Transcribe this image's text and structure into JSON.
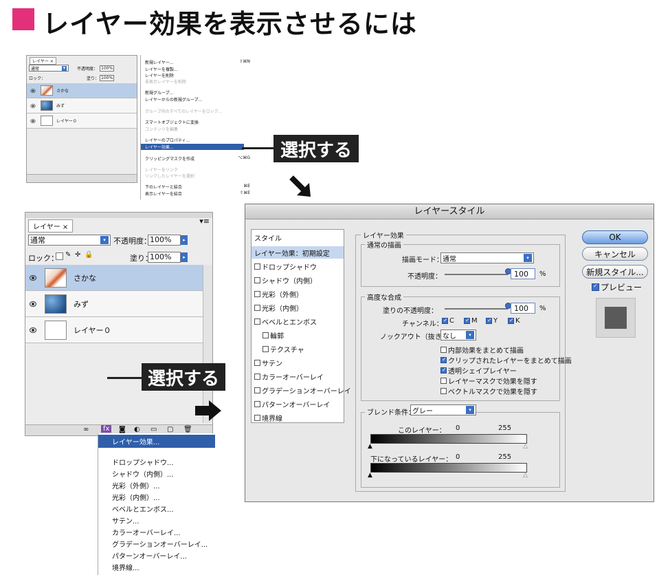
{
  "page_title": "レイヤー効果を表示させるには",
  "callout": "選択する",
  "small_layers_panel": {
    "tab": "レイヤー ×",
    "blend": "通常",
    "opacity_label": "不透明度：",
    "opacity_value": "100%",
    "lock_label": "ロック：",
    "fill_label": "塗り：",
    "fill_value": "100%",
    "layers": [
      "さかな",
      "みず",
      "レイヤー０"
    ]
  },
  "context_menu": {
    "items": [
      {
        "label": "新規レイヤー...",
        "shortcut": "⇧⌘N"
      },
      {
        "label": "レイヤーを複製...",
        "shortcut": ""
      },
      {
        "label": "レイヤーを削除",
        "shortcut": ""
      },
      {
        "label": "非表示レイヤーを削除",
        "shortcut": ""
      },
      {
        "label": "新規グループ...",
        "shortcut": ""
      },
      {
        "label": "レイヤーからの新規グループ...",
        "shortcut": ""
      },
      {
        "label": "グループ内のすべてのレイヤーをロック...",
        "shortcut": ""
      },
      {
        "label": "スマートオブジェクトに変換",
        "shortcut": ""
      },
      {
        "label": "コンテンツを編集",
        "shortcut": ""
      },
      {
        "label": "レイヤーのプロパティ...",
        "shortcut": ""
      },
      {
        "label": "レイヤー効果...",
        "shortcut": ""
      },
      {
        "label": "クリッピングマスクを作成",
        "shortcut": "⌥⌘G"
      },
      {
        "label": "レイヤーをリンク",
        "shortcut": ""
      },
      {
        "label": "リンクしたレイヤーを選択",
        "shortcut": ""
      },
      {
        "label": "下のレイヤーと結合",
        "shortcut": "⌘E"
      },
      {
        "label": "表示レイヤーを結合",
        "shortcut": "⇧⌘E"
      }
    ]
  },
  "large_layers_panel": {
    "tab": "レイヤー ×",
    "blend": "通常",
    "opacity_label": "不透明度：",
    "opacity_value": "100%",
    "lock_label": "ロック：",
    "fill_label": "塗り：",
    "fill_value": "100%",
    "layers": [
      "さかな",
      "みず",
      "レイヤー０"
    ]
  },
  "fx_menu": {
    "items": [
      "レイヤー効果...",
      "ドロップシャドウ...",
      "シャドウ（内側）...",
      "光彩（外側）...",
      "光彩（内側）...",
      "ベベルとエンボス...",
      "サテン...",
      "カラーオーバーレイ...",
      "グラデーションオーバーレイ...",
      "パターンオーバーレイ...",
      "境界線..."
    ]
  },
  "dialog": {
    "title": "レイヤースタイル",
    "styles_header": "スタイル",
    "styles": [
      {
        "label": "レイヤー効果：初期設定",
        "check": false,
        "indent": false
      },
      {
        "label": "ドロップシャドウ",
        "check": true,
        "indent": false
      },
      {
        "label": "シャドウ（内側）",
        "check": true,
        "indent": false
      },
      {
        "label": "光彩（外側）",
        "check": true,
        "indent": false
      },
      {
        "label": "光彩（内側）",
        "check": true,
        "indent": false
      },
      {
        "label": "ベベルとエンボス",
        "check": true,
        "indent": false
      },
      {
        "label": "輪郭",
        "check": true,
        "indent": true
      },
      {
        "label": "テクスチャ",
        "check": true,
        "indent": true
      },
      {
        "label": "サテン",
        "check": true,
        "indent": false
      },
      {
        "label": "カラーオーバーレイ",
        "check": true,
        "indent": false
      },
      {
        "label": "グラデーションオーバーレイ",
        "check": true,
        "indent": false
      },
      {
        "label": "パターンオーバーレイ",
        "check": true,
        "indent": false
      },
      {
        "label": "境界線",
        "check": true,
        "indent": false
      }
    ],
    "effects_group": "レイヤー効果",
    "general_blending": "通常の描画",
    "blend_mode_label": "描画モード：",
    "blend_mode_value": "通常",
    "opacity_label": "不透明度：",
    "opacity_value": "100",
    "percent": "%",
    "advanced_blending": "高度な合成",
    "fill_opacity_label": "塗りの不透明度：",
    "fill_opacity_value": "100",
    "channels_label": "チャンネル：",
    "channels": [
      "C",
      "M",
      "Y",
      "K"
    ],
    "knockout_label": "ノックアウト（抜き）：",
    "knockout_value": "なし",
    "options": [
      {
        "label": "内部効果をまとめて描画",
        "checked": false
      },
      {
        "label": "クリップされたレイヤーをまとめて描画",
        "checked": true
      },
      {
        "label": "透明シェイプレイヤー",
        "checked": true
      },
      {
        "label": "レイヤーマスクで効果を隠す",
        "checked": false
      },
      {
        "label": "ベクトルマスクで効果を隠す",
        "checked": false
      }
    ],
    "blend_if_label": "ブレンド条件：",
    "blend_if_value": "グレー",
    "this_layer_label": "このレイヤー：",
    "underlying_label": "下になっているレイヤー：",
    "range_min": "0",
    "range_max": "255",
    "ok": "OK",
    "cancel": "キャンセル",
    "new_style": "新規スタイル...",
    "preview": "プレビュー"
  },
  "colors": {
    "accent": "#e3307a",
    "highlight": "#2f5faa",
    "callout_bg": "#222222"
  }
}
